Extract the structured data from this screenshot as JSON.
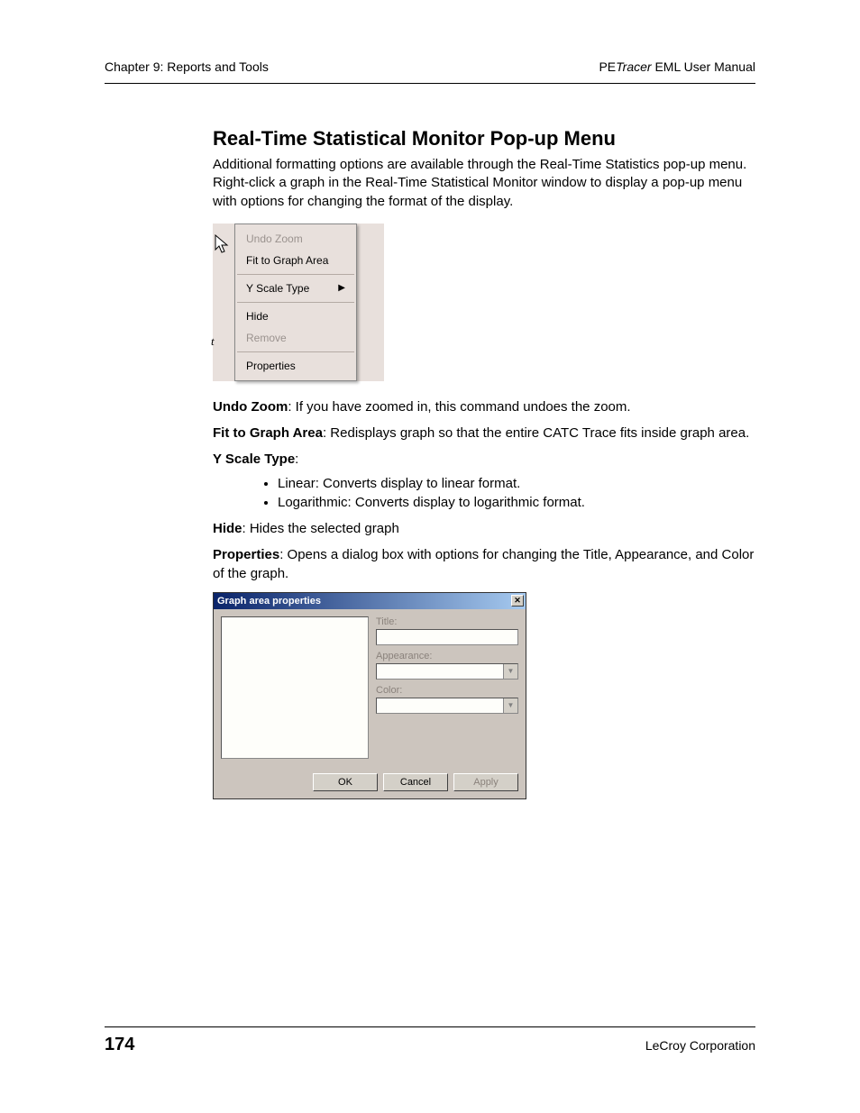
{
  "header": {
    "left": "Chapter 9: Reports and Tools",
    "right_prefix": "PE",
    "right_italic": "Tracer",
    "right_suffix": " EML User Manual"
  },
  "title": "Real-Time Statistical Monitor Pop-up Menu",
  "intro": "Additional formatting options are available through the Real-Time Statistics pop-up menu. Right-click a graph in the Real-Time Statistical Monitor window to display a pop-up menu with options for changing the format of the display.",
  "menu": {
    "undo_zoom": "Undo Zoom",
    "fit": "Fit to Graph Area",
    "yscale": "Y Scale Type",
    "hide": "Hide",
    "remove": "Remove",
    "properties": "Properties"
  },
  "desc": {
    "undo_label": "Undo Zoom",
    "undo_text": ": If you have zoomed in, this command undoes the zoom.",
    "fit_label": "Fit to Graph Area",
    "fit_text": ": Redisplays graph so that the entire CATC Trace fits inside graph area.",
    "yscale_label": "Y Scale Type",
    "yscale_colon": ":",
    "linear_label": "Linear",
    "linear_text": ": Converts display to linear format.",
    "log_label": "Logarithmic",
    "log_text": ": Converts display to logarithmic format.",
    "hide_label": "Hide",
    "hide_text": ": Hides the selected graph",
    "props_label": "Properties",
    "props_text": ": Opens a dialog box with options for changing the Title, Appearance, and Color of the graph."
  },
  "dialog": {
    "title": "Graph area properties",
    "title_label": "Title:",
    "appearance_label": "Appearance:",
    "color_label": "Color:",
    "ok": "OK",
    "cancel": "Cancel",
    "apply": "Apply"
  },
  "footer": {
    "page": "174",
    "company": "LeCroy Corporation"
  }
}
